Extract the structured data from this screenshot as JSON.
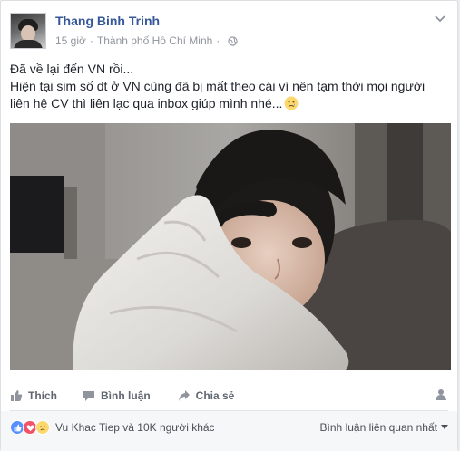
{
  "post": {
    "author_name": "Thang Binh Trinh",
    "time": "15 giờ",
    "location": "Thành phố Hồ Chí Minh",
    "text_lines": [
      "Đã về lại đến VN rồi...",
      "Hiện tại sim số dt ở VN cũng đã bị mất theo cái ví nên tạm thời mọi người",
      "liên hệ CV thì liên lạc qua inbox giúp mình nhé..."
    ],
    "emoji": "crying-face-icon"
  },
  "actions": {
    "like_label": "Thích",
    "comment_label": "Bình luận",
    "share_label": "Chia sẻ"
  },
  "footer": {
    "reaction_summary": "Vu Khac Tiep và 10K người khác",
    "sort_label": "Bình luận liên quan nhất"
  },
  "colors": {
    "name_link": "#365899",
    "like_reaction": "#5890ff",
    "love_reaction": "#f25268",
    "sad_reaction": "#fcd86f"
  }
}
